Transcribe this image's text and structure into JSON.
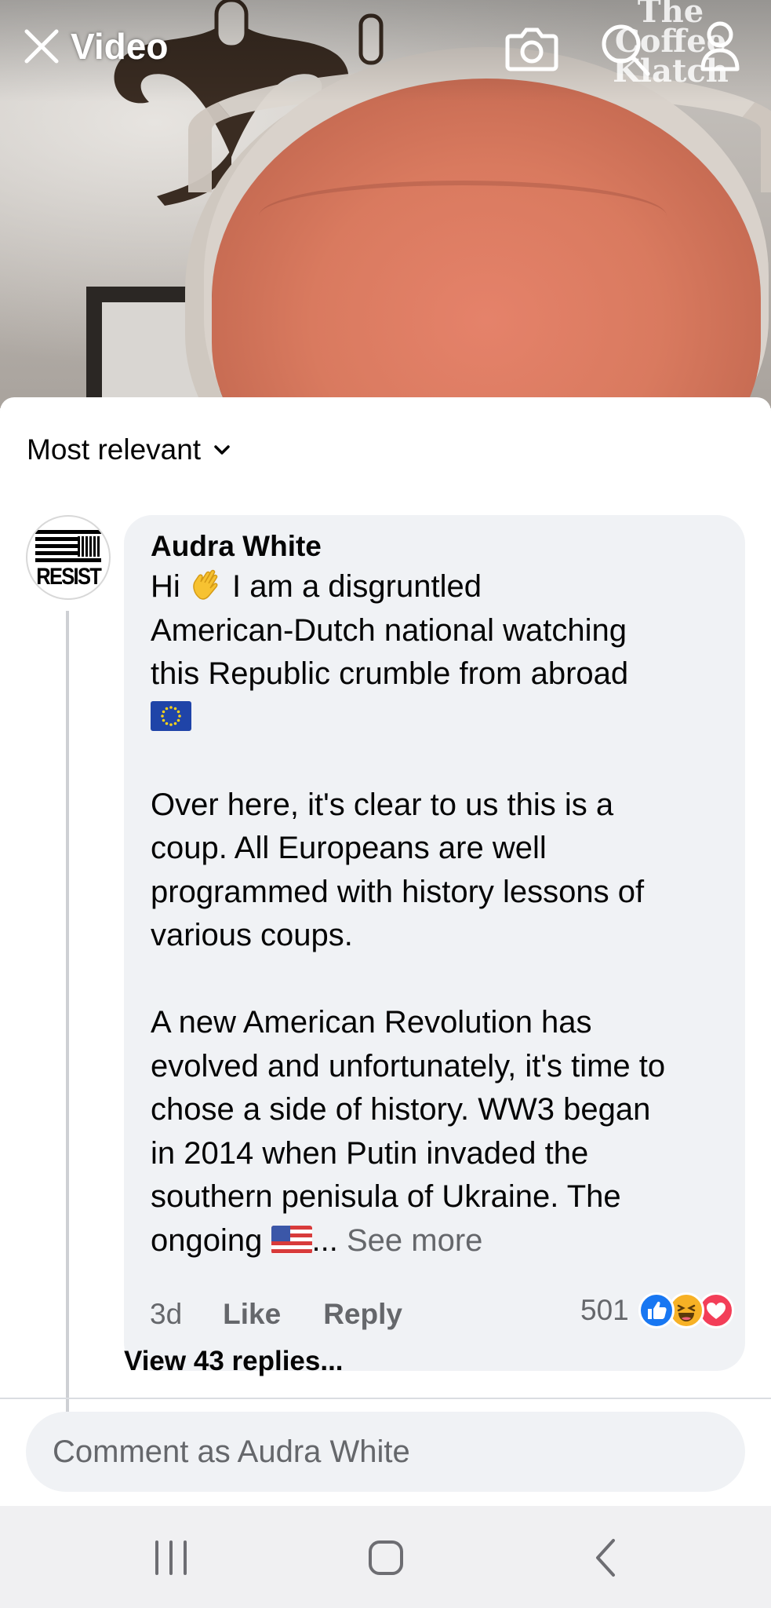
{
  "video": {
    "title": "Video",
    "watermark": [
      "The",
      "Coffee",
      "Klatch"
    ],
    "icons": [
      "close-icon",
      "camera-icon",
      "search-icon",
      "profile-icon"
    ]
  },
  "comments": {
    "sort_label": "Most relevant",
    "comment": {
      "author": "Audra White",
      "avatar_text": "RESIST",
      "paragraph1_line1_a": "Hi",
      "paragraph1_line1_b": "I am a disgruntled",
      "paragraph1_line2": "American-Dutch national watching",
      "paragraph1_line3": "this Republic crumble from abroad",
      "paragraph2_lines": [
        "Over here, it's clear to us this is a",
        "coup. All Europeans are well",
        "programmed with history lessons of",
        "various coups."
      ],
      "paragraph3_lines": [
        "A new American Revolution has",
        "evolved and unfortunately, it's time to",
        "chose a side of history. WW3 began",
        "in 2014 when Putin invaded the",
        "southern penisula of Ukraine. The"
      ],
      "last_line_start": "ongoing",
      "ellipsis": "...",
      "see_more": "See more",
      "time": "3d",
      "like_label": "Like",
      "reply_label": "Reply",
      "reaction_count": "501",
      "reaction_types": [
        "like",
        "haha",
        "love"
      ],
      "view_replies": "View 43 replies..."
    },
    "input_placeholder": "Comment as Audra White"
  },
  "colors": {
    "facebook_blue": "#1877f2",
    "secondary_text": "#65676b",
    "bubble_bg": "#f0f2f5",
    "love_red": "#f33e58",
    "haha_yellow": "#f7b125"
  }
}
